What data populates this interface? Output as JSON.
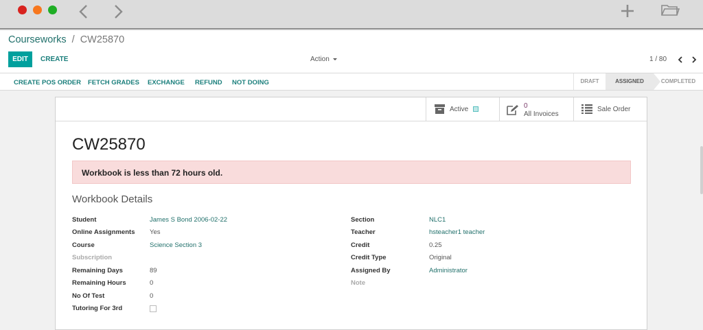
{
  "toolbar": {
    "breadcrumb_parent": "Courseworks",
    "breadcrumb_separator": "/",
    "breadcrumb_current": "CW25870",
    "edit_label": "EDIT",
    "create_label": "CREATE",
    "action_label": "Action",
    "pager": "1 / 80"
  },
  "header_buttons": [
    "CREATE POS ORDER",
    "FETCH GRADES",
    "EXCHANGE",
    "REFUND",
    "NOT DOING"
  ],
  "status_stages": {
    "draft": "DRAFT",
    "assigned": "ASSIGNED",
    "completed": "COMPLETED"
  },
  "smart_buttons": {
    "active_label": "Active",
    "invoices_count": "0",
    "invoices_label": "All Invoices",
    "sale_order_label": "Sale Order"
  },
  "record": {
    "title": "CW25870",
    "alert": "Workbook is less than 72 hours old.",
    "section_title": "Workbook Details"
  },
  "left_fields": [
    {
      "label": "Student",
      "value": "James S Bond 2006-02-22"
    },
    {
      "label": "Online Assignments",
      "value": "Yes"
    },
    {
      "label": "Course",
      "value": "Science Section 3"
    },
    {
      "label": "Subscription",
      "value": ""
    },
    {
      "label": "Remaining Days",
      "value": "89"
    },
    {
      "label": "Remaining Hours",
      "value": "0"
    },
    {
      "label": "No Of Test",
      "value": "0"
    },
    {
      "label": "Tutoring For 3rd",
      "value": ""
    }
  ],
  "right_fields": [
    {
      "label": "Section",
      "value": "NLC1"
    },
    {
      "label": "Teacher",
      "value": "hsteacher1 teacher"
    },
    {
      "label": "Credit",
      "value": "0.25"
    },
    {
      "label": "Credit Type",
      "value": "Original"
    },
    {
      "label": "Assigned By",
      "value": "Administrator"
    },
    {
      "label": "Note",
      "value": ""
    }
  ],
  "icons": {
    "window_close": "red-dot",
    "window_minimize": "orange-dot",
    "window_zoom": "green-dot",
    "back": "chevron-left-icon",
    "forward": "chevron-right-icon",
    "new_tab": "plus-icon",
    "open": "folder-icon",
    "archive": "archive-icon",
    "invoice": "pencil-square-icon",
    "list": "list-icon"
  },
  "colors": {
    "primary": "#00a09d",
    "link": "#21706b",
    "alert_bg": "#f9dcdc",
    "close": "#d8231f",
    "minimize": "#f7771e",
    "zoom": "#1fae25"
  }
}
